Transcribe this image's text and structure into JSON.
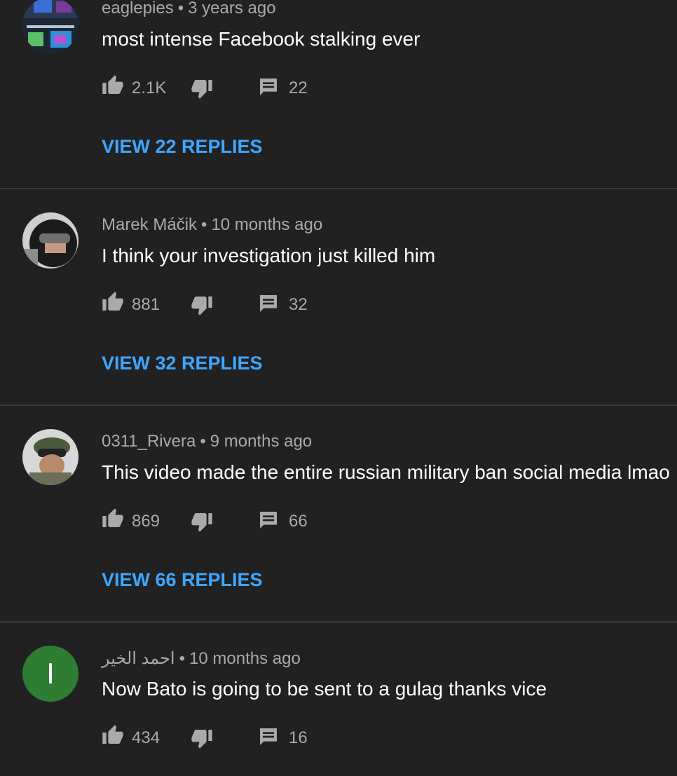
{
  "comments": [
    {
      "author": "eaglepies",
      "time": "3 years ago",
      "text": "most intense Facebook stalking ever",
      "likes": "2.1K",
      "replies_count": "22",
      "view_replies": "VIEW 22 REPLIES"
    },
    {
      "author": "Marek Máčik",
      "time": "10 months ago",
      "text": "I think your investigation just killed him",
      "likes": "881",
      "replies_count": "32",
      "view_replies": "VIEW 32 REPLIES"
    },
    {
      "author": "0311_Rivera",
      "time": "9 months ago",
      "text": "This video made the entire russian military ban social media lmao",
      "likes": "869",
      "replies_count": "66",
      "view_replies": "VIEW 66 REPLIES"
    },
    {
      "author": "احمد الخير",
      "time": "10 months ago",
      "text": "Now Bato is going to be sent to a gulag thanks vice",
      "likes": "434",
      "replies_count": "16",
      "avatar_letter": "I"
    }
  ],
  "separator": "•",
  "colors": {
    "background": "#212121",
    "link": "#3ea6ff",
    "secondary_text": "#aaaaaa",
    "avatar_green": "#2e7d32"
  },
  "icons": [
    "thumbs-up-icon",
    "thumbs-down-icon",
    "reply-icon"
  ]
}
